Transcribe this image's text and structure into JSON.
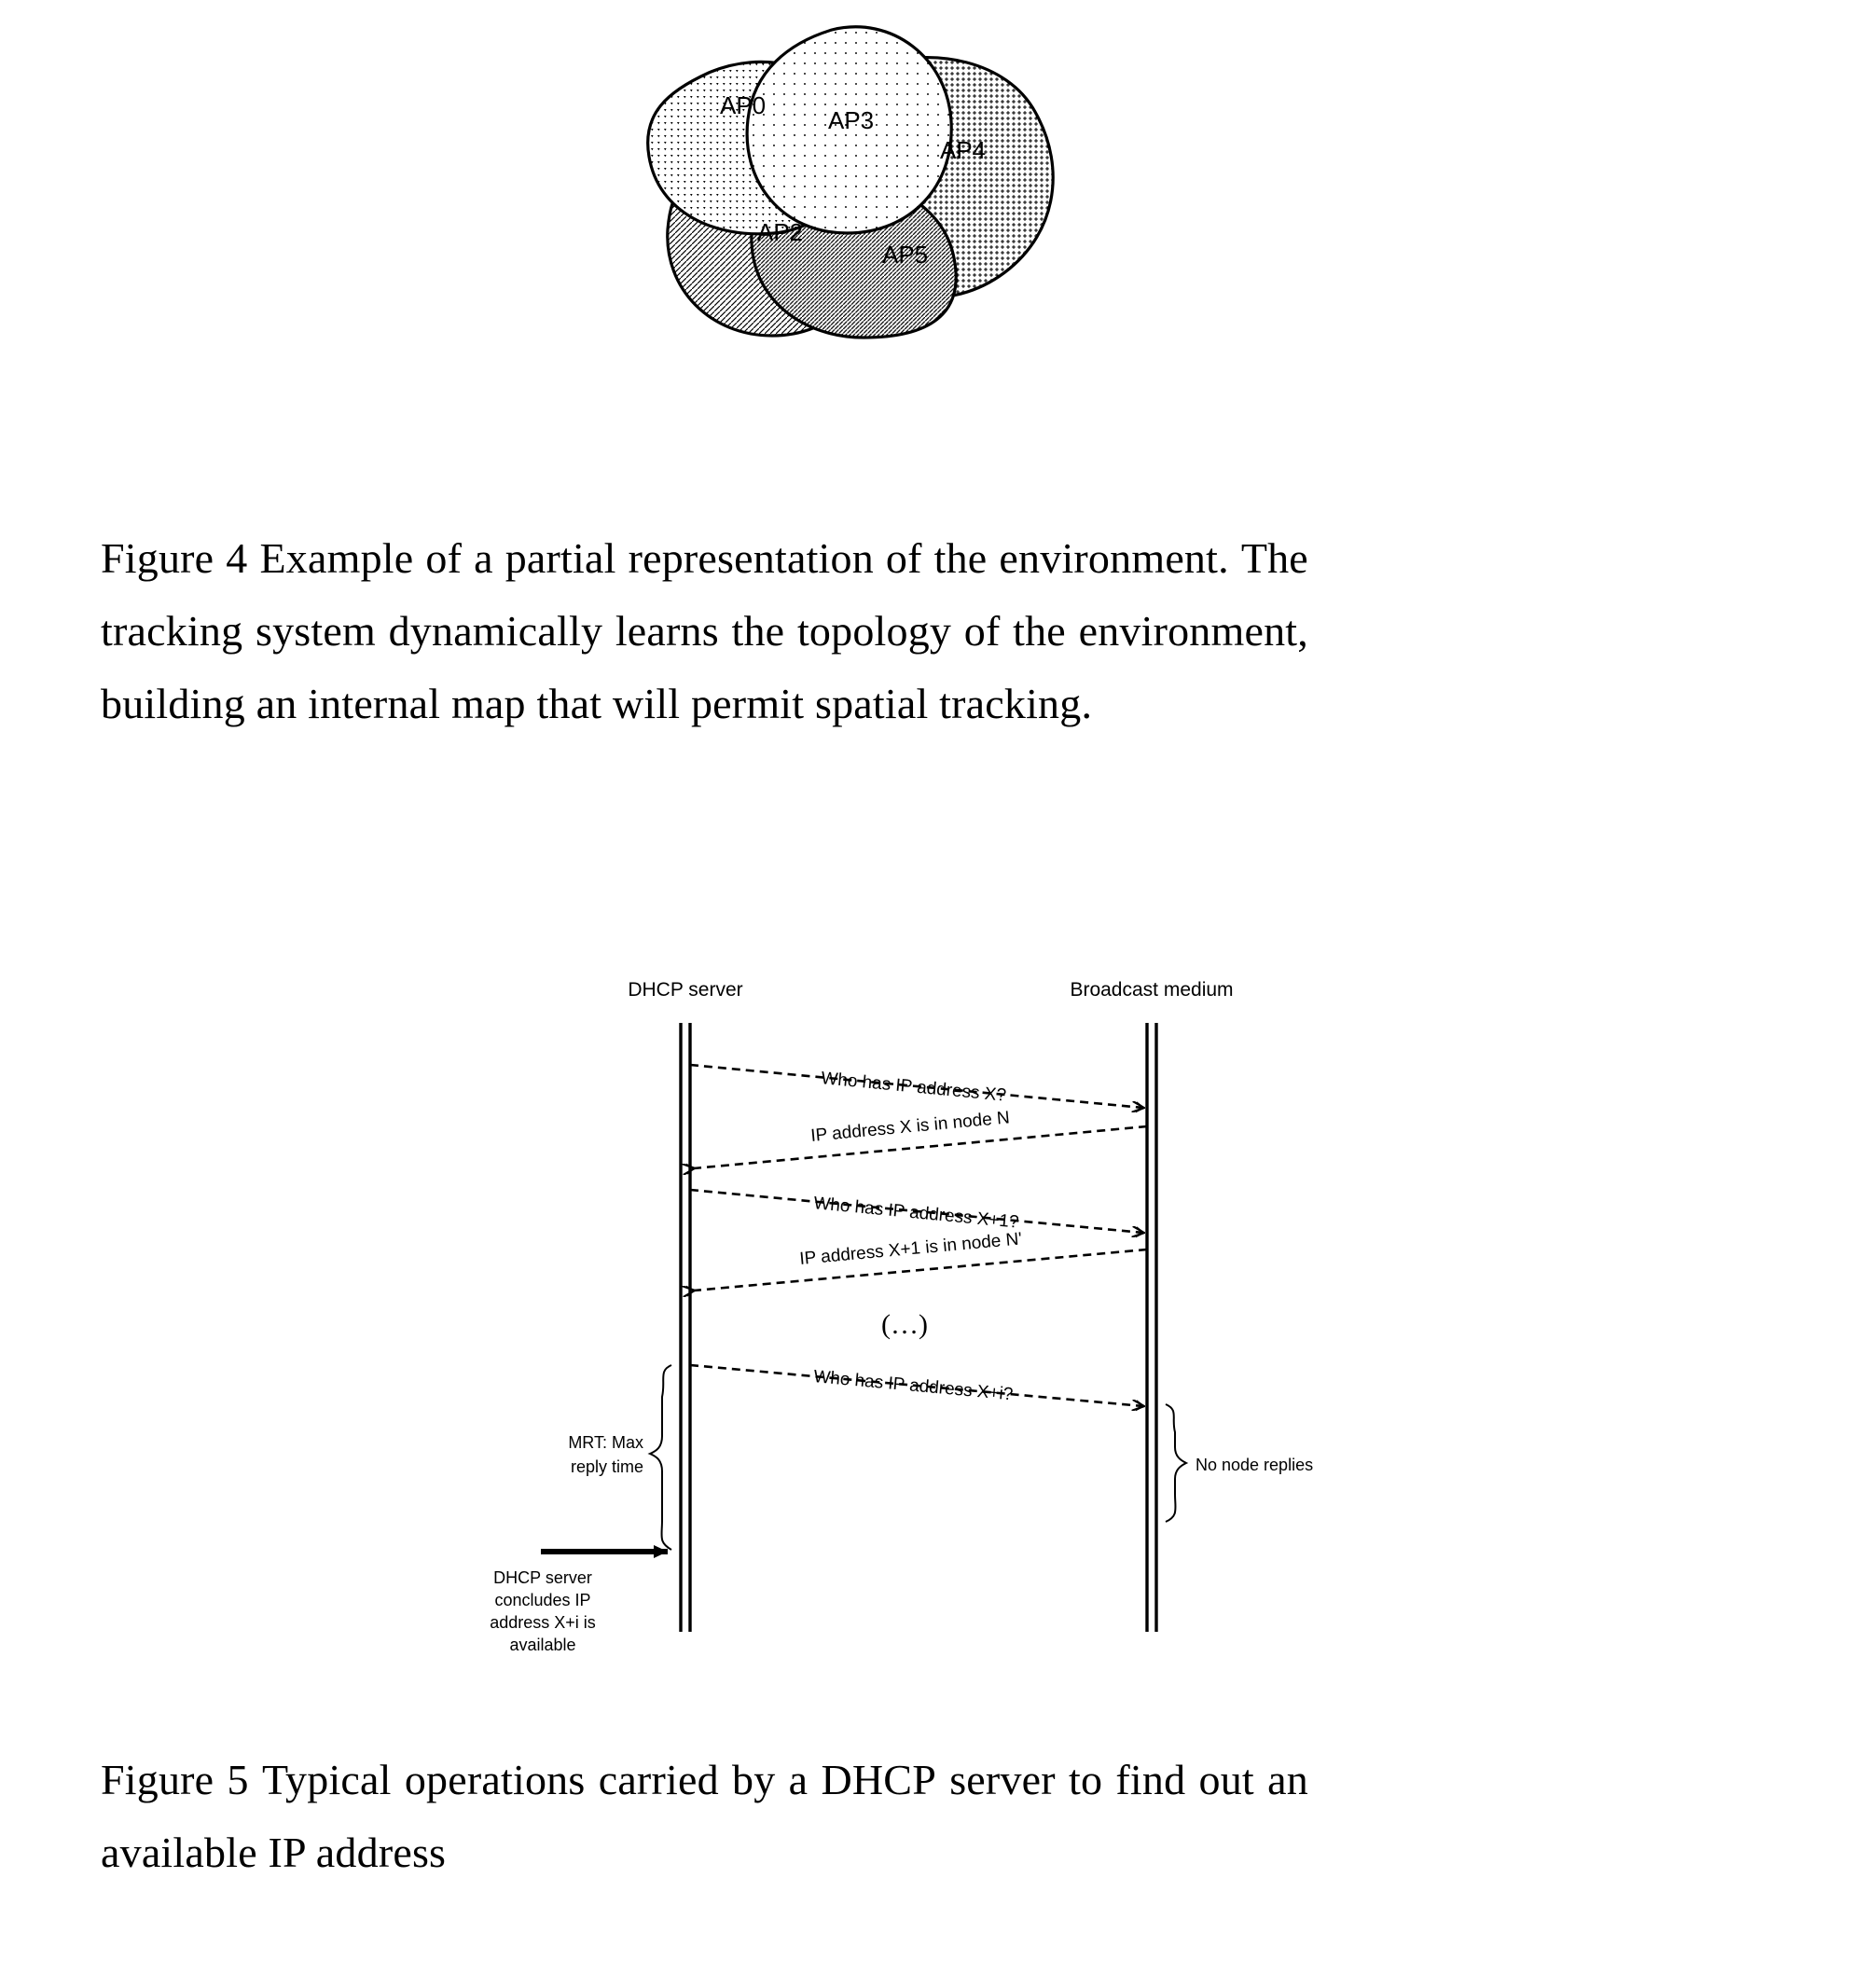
{
  "figure4": {
    "caption_number": "Figure 4",
    "caption_text": "Figure 4 Example of a partial representation of the environment. The tracking system dynamically learns the topology of the environment, building an internal map that will permit spatial tracking.",
    "caption_lines": [
      [
        "Figure",
        "4",
        "Example",
        "of",
        "a",
        "partial",
        "representation",
        "of",
        "the",
        "environment.",
        "The"
      ],
      [
        "tracking",
        "system",
        "dynamically",
        "learns",
        "the",
        "topology",
        "of",
        "the",
        "environment,"
      ],
      [
        "building an internal map that will permit spatial tracking."
      ]
    ],
    "regions": [
      {
        "id": "ap0",
        "label": "AP0",
        "pattern": "triangle-dots-medium"
      },
      {
        "id": "ap3",
        "label": "AP3",
        "pattern": "sparse-dots-light"
      },
      {
        "id": "ap4",
        "label": "AP4",
        "pattern": "cross-dots-dense"
      },
      {
        "id": "ap2",
        "label": "AP2",
        "pattern": "diagonal-hatch-medium"
      },
      {
        "id": "ap5",
        "label": "AP5",
        "pattern": "diagonal-hatch-dense"
      }
    ],
    "colors": {
      "stroke": "#000000",
      "fill": "#ffffff"
    }
  },
  "figure5": {
    "caption_number": "Figure 5",
    "caption_text": "Figure 5 Typical operations carried by a DHCP server to find out an available IP address",
    "caption_lines": [
      [
        "Figure",
        "5",
        "Typical",
        "operations",
        "carried",
        "by",
        "a",
        "DHCP",
        "server",
        "to",
        "find",
        "out",
        "an"
      ],
      [
        "available IP address"
      ]
    ],
    "lifelines": [
      {
        "id": "dhcp-server",
        "label": "DHCP server"
      },
      {
        "id": "broadcast-medium",
        "label": "Broadcast medium"
      }
    ],
    "messages": [
      {
        "id": "msg-1",
        "label": "Who has IP address X?",
        "direction": "right"
      },
      {
        "id": "msg-2",
        "label": "IP address X is in node N",
        "direction": "left"
      },
      {
        "id": "msg-3",
        "label": "Who has IP address X+1?",
        "direction": "right"
      },
      {
        "id": "msg-4",
        "label": "IP address X+1 is in node N'",
        "direction": "left"
      },
      {
        "id": "msg-5",
        "label": "Who has IP address X+i?",
        "direction": "right"
      }
    ],
    "ellipsis": "(…)",
    "annotations": [
      {
        "id": "mrt",
        "lines": [
          "MRT: Max",
          "reply time"
        ]
      },
      {
        "id": "no-node-replies",
        "lines": [
          "No node replies"
        ]
      },
      {
        "id": "conclusion",
        "lines": [
          "DHCP server",
          "concludes IP",
          "address X+i is",
          "available"
        ]
      }
    ],
    "colors": {
      "stroke": "#000000"
    }
  }
}
